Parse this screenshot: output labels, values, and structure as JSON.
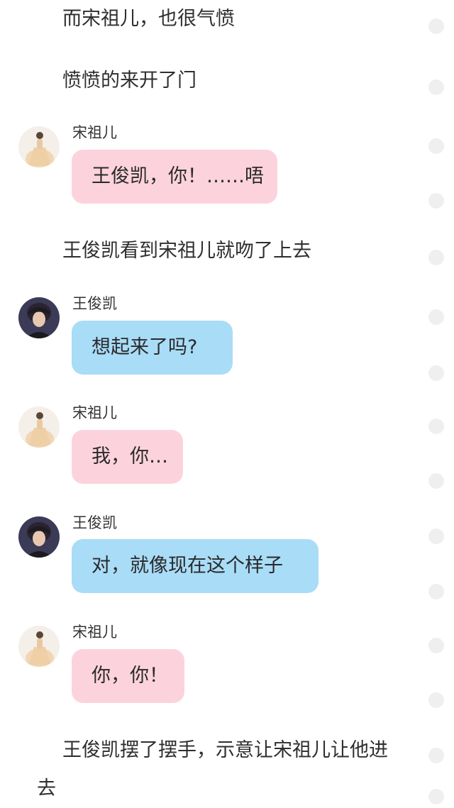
{
  "story": {
    "lines": [
      "而宋祖儿，也很气愤",
      "愤愤的来开了门",
      "王俊凯看到宋祖儿就吻了上去",
      "王俊凯摆了摆手，示意让宋祖儿让他进去"
    ],
    "messages": [
      {
        "speaker": "宋祖儿",
        "text": "王俊凯，你！……唔",
        "avatar": "avatar-songzuer"
      },
      {
        "speaker": "王俊凯",
        "text": "想起来了吗?",
        "avatar": "avatar-wangjunkai"
      },
      {
        "speaker": "宋祖儿",
        "text": "我，你…",
        "avatar": "avatar-songzuer"
      },
      {
        "speaker": "王俊凯",
        "text": "对，就像现在这个样子",
        "avatar": "avatar-wangjunkai"
      },
      {
        "speaker": "宋祖儿",
        "text": "你，你！",
        "avatar": "avatar-songzuer"
      }
    ]
  },
  "colors": {
    "bubble_pink": "#fcd3dd",
    "bubble_blue": "#a9dcf7",
    "side_dot": "#efefef"
  }
}
